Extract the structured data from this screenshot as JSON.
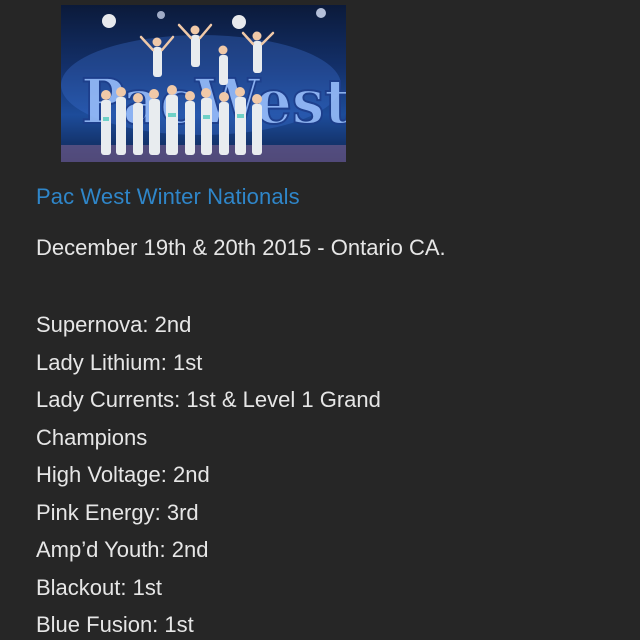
{
  "photo": {
    "banner_text": "PacWest",
    "alt": "Cheer team stunting on stage"
  },
  "event": {
    "title": "Pac West Winter Nationals",
    "date_line": "December 19th & 20th 2015 - Ontario CA."
  },
  "results": [
    "Supernova: 2nd",
    "Lady Lithium: 1st",
    "Lady Currents: 1st & Level 1 Grand",
    "Champions",
    "High Voltage: 2nd",
    "Pink Energy: 3rd",
    "Amp’d Youth: 2nd",
    "Blackout: 1st",
    "Blue Fusion: 1st"
  ],
  "colors": {
    "background": "#262626",
    "link": "#2f86c9",
    "text": "#e6e6e6"
  }
}
